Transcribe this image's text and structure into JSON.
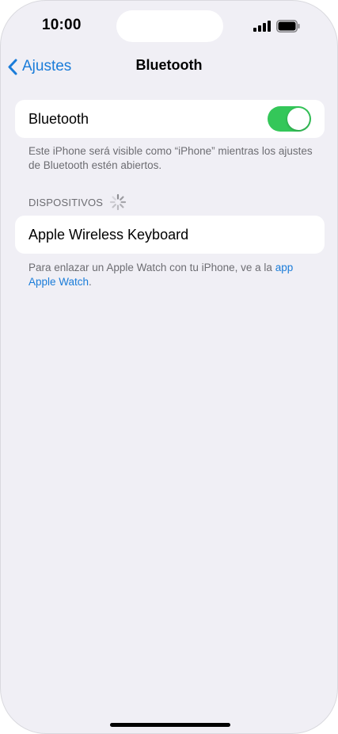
{
  "status_bar": {
    "time": "10:00",
    "signal_icon": "cellular-signal-icon",
    "battery_icon": "battery-icon"
  },
  "nav": {
    "back_label": "Ajustes",
    "title": "Bluetooth"
  },
  "bluetooth_cell": {
    "label": "Bluetooth",
    "toggle_on": true,
    "toggle_color": "#34c759"
  },
  "visibility_note": "Este iPhone será visible como “iPhone” mientras los ajustes de Bluetooth estén abiertos.",
  "devices": {
    "header": "DISPOSITIVOS",
    "items": [
      {
        "name": "Apple Wireless Keyboard"
      }
    ]
  },
  "watch_note": {
    "text": "Para enlazar un Apple Watch con tu iPhone, ve a la ",
    "link": "app Apple Watch",
    "suffix": "."
  },
  "colors": {
    "accent": "#1a7cd9",
    "background": "#f0eff5"
  }
}
